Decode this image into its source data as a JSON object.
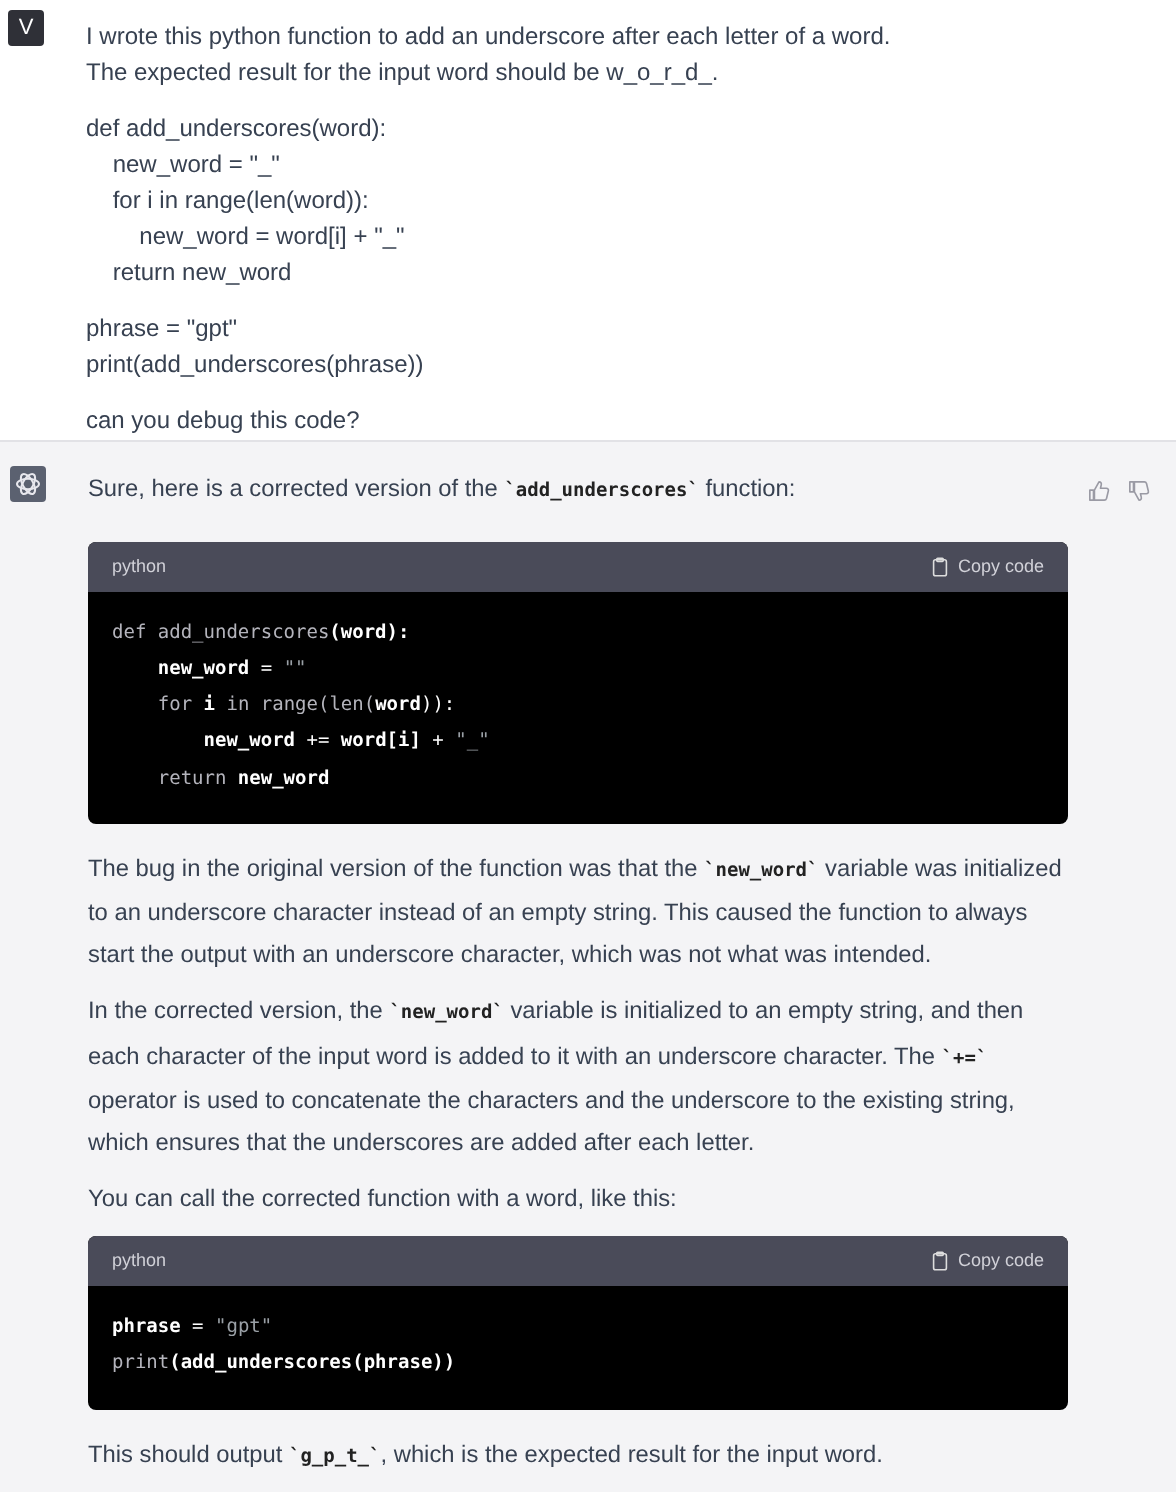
{
  "messages": [
    {
      "kind": "user",
      "avatar": "V",
      "paragraphs": [
        {
          "kind": "lines",
          "lines": [
            "I wrote this python function to add an underscore after each letter of a word.",
            "The expected result for the input word should be w_o_r_d_."
          ]
        },
        {
          "kind": "lines",
          "lines": [
            "def add_underscores(word):",
            "    new_word = \"_\"",
            "    for i in range(len(word)):",
            "        new_word = word[i] + \"_\"",
            "    return new_word"
          ]
        },
        {
          "kind": "lines",
          "lines": [
            "phrase = \"gpt\"",
            "print(add_underscores(phrase))"
          ]
        },
        {
          "kind": "lines",
          "lines": [
            "can you debug this code?"
          ]
        }
      ]
    },
    {
      "kind": "assistant",
      "paragraphs": [
        {
          "kind": "text",
          "segments": [
            {
              "kind": "text",
              "t": "Sure, here is a corrected version of the "
            },
            {
              "kind": "code",
              "t": "`add_underscores`"
            },
            {
              "kind": "text",
              "t": " function:"
            }
          ]
        },
        {
          "kind": "code",
          "language": "python",
          "copy_label": "Copy code",
          "lines": [
            [
              {
                "kind": "kw",
                "t": "def add_underscores"
              },
              {
                "kind": "name",
                "t": "(word):"
              }
            ],
            [
              {
                "kind": "name",
                "t": "    new_word"
              },
              {
                "kind": "plain",
                "t": " = "
              },
              {
                "kind": "str",
                "t": "\"\""
              }
            ],
            [
              {
                "kind": "kw",
                "t": "    for "
              },
              {
                "kind": "name",
                "t": "i"
              },
              {
                "kind": "kw",
                "t": " in range(len("
              },
              {
                "kind": "name",
                "t": "word"
              },
              {
                "kind": "plain",
                "t": ")):"
              }
            ],
            [
              {
                "kind": "name",
                "t": "        new_word"
              },
              {
                "kind": "plain",
                "t": " += "
              },
              {
                "kind": "name",
                "t": "word[i]"
              },
              {
                "kind": "plain",
                "t": " + "
              },
              {
                "kind": "str",
                "t": "\"_\""
              }
            ],
            [
              {
                "kind": "kw",
                "t": "    return "
              },
              {
                "kind": "name",
                "t": "new_word"
              }
            ]
          ]
        },
        {
          "kind": "text",
          "segments": [
            {
              "kind": "text",
              "t": "The bug in the original version of the function was that the "
            },
            {
              "kind": "code",
              "t": "`new_word`"
            },
            {
              "kind": "text",
              "t": " variable was initialized to an underscore character instead of an empty string. This caused the function to always start the output with an underscore character, which was not what was intended."
            }
          ]
        },
        {
          "kind": "text",
          "segments": [
            {
              "kind": "text",
              "t": "In the corrected version, the "
            },
            {
              "kind": "code",
              "t": "`new_word`"
            },
            {
              "kind": "text",
              "t": " variable is initialized to an empty string, and then each character of the input word is added to it with an underscore character. The "
            },
            {
              "kind": "code",
              "t": "`+=`"
            },
            {
              "kind": "text",
              "t": " operator is used to concatenate the characters and the underscore to the existing string, which ensures that the underscores are added after each letter."
            }
          ]
        },
        {
          "kind": "text",
          "segments": [
            {
              "kind": "text",
              "t": "You can call the corrected function with a word, like this:"
            }
          ]
        },
        {
          "kind": "code",
          "language": "python",
          "copy_label": "Copy code",
          "lines": [
            [
              {
                "kind": "name",
                "t": "phrase"
              },
              {
                "kind": "plain",
                "t": " = "
              },
              {
                "kind": "str",
                "t": "\"gpt\""
              }
            ],
            [
              {
                "kind": "kw",
                "t": "print"
              },
              {
                "kind": "name",
                "t": "(add_underscores(phrase))"
              }
            ]
          ]
        },
        {
          "kind": "text",
          "segments": [
            {
              "kind": "text",
              "t": "This should output "
            },
            {
              "kind": "code",
              "t": "`g_p_t_`"
            },
            {
              "kind": "text",
              "t": ", which is the expected result for the input word."
            }
          ]
        }
      ]
    }
  ]
}
